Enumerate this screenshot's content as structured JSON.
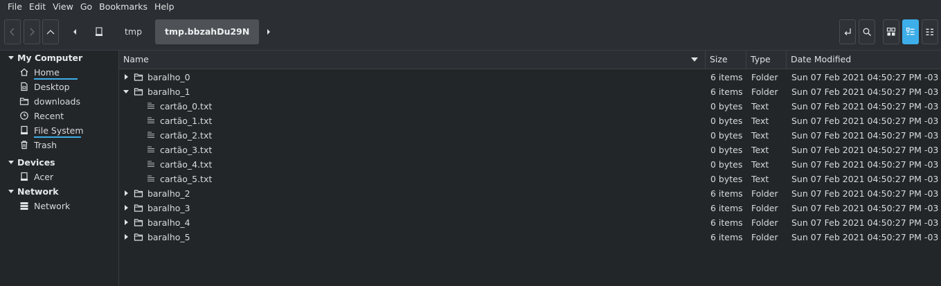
{
  "menu": [
    "File",
    "Edit",
    "View",
    "Go",
    "Bookmarks",
    "Help"
  ],
  "toolbar": {
    "breadcrumbs": [
      "tmp",
      "tmp.bbzahDu29N"
    ]
  },
  "sidebar": {
    "sections": [
      {
        "title": "My Computer",
        "items": [
          "Home",
          "Desktop",
          "downloads",
          "Recent",
          "File System",
          "Trash"
        ]
      },
      {
        "title": "Devices",
        "items": [
          "Acer"
        ]
      },
      {
        "title": "Network",
        "items": [
          "Network"
        ]
      }
    ]
  },
  "columns": {
    "name": "Name",
    "size": "Size",
    "type": "Type",
    "modified": "Date Modified"
  },
  "rows": [
    {
      "name": "baralho_0",
      "size": "6 items",
      "type": "Folder",
      "modified": "Sun 07 Feb 2021 04:50:27 PM -03"
    },
    {
      "name": "baralho_1",
      "size": "6 items",
      "type": "Folder",
      "modified": "Sun 07 Feb 2021 04:50:27 PM -03"
    },
    {
      "name": "cartão_0.txt",
      "size": "0 bytes",
      "type": "Text",
      "modified": "Sun 07 Feb 2021 04:50:27 PM -03"
    },
    {
      "name": "cartão_1.txt",
      "size": "0 bytes",
      "type": "Text",
      "modified": "Sun 07 Feb 2021 04:50:27 PM -03"
    },
    {
      "name": "cartão_2.txt",
      "size": "0 bytes",
      "type": "Text",
      "modified": "Sun 07 Feb 2021 04:50:27 PM -03"
    },
    {
      "name": "cartão_3.txt",
      "size": "0 bytes",
      "type": "Text",
      "modified": "Sun 07 Feb 2021 04:50:27 PM -03"
    },
    {
      "name": "cartão_4.txt",
      "size": "0 bytes",
      "type": "Text",
      "modified": "Sun 07 Feb 2021 04:50:27 PM -03"
    },
    {
      "name": "cartão_5.txt",
      "size": "0 bytes",
      "type": "Text",
      "modified": "Sun 07 Feb 2021 04:50:27 PM -03"
    },
    {
      "name": "baralho_2",
      "size": "6 items",
      "type": "Folder",
      "modified": "Sun 07 Feb 2021 04:50:27 PM -03"
    },
    {
      "name": "baralho_3",
      "size": "6 items",
      "type": "Folder",
      "modified": "Sun 07 Feb 2021 04:50:27 PM -03"
    },
    {
      "name": "baralho_4",
      "size": "6 items",
      "type": "Folder",
      "modified": "Sun 07 Feb 2021 04:50:27 PM -03"
    },
    {
      "name": "baralho_5",
      "size": "6 items",
      "type": "Folder",
      "modified": "Sun 07 Feb 2021 04:50:27 PM -03"
    }
  ],
  "colors": {
    "accent": "#3daee9",
    "background": "#232629",
    "chrome": "#2b2e32"
  }
}
